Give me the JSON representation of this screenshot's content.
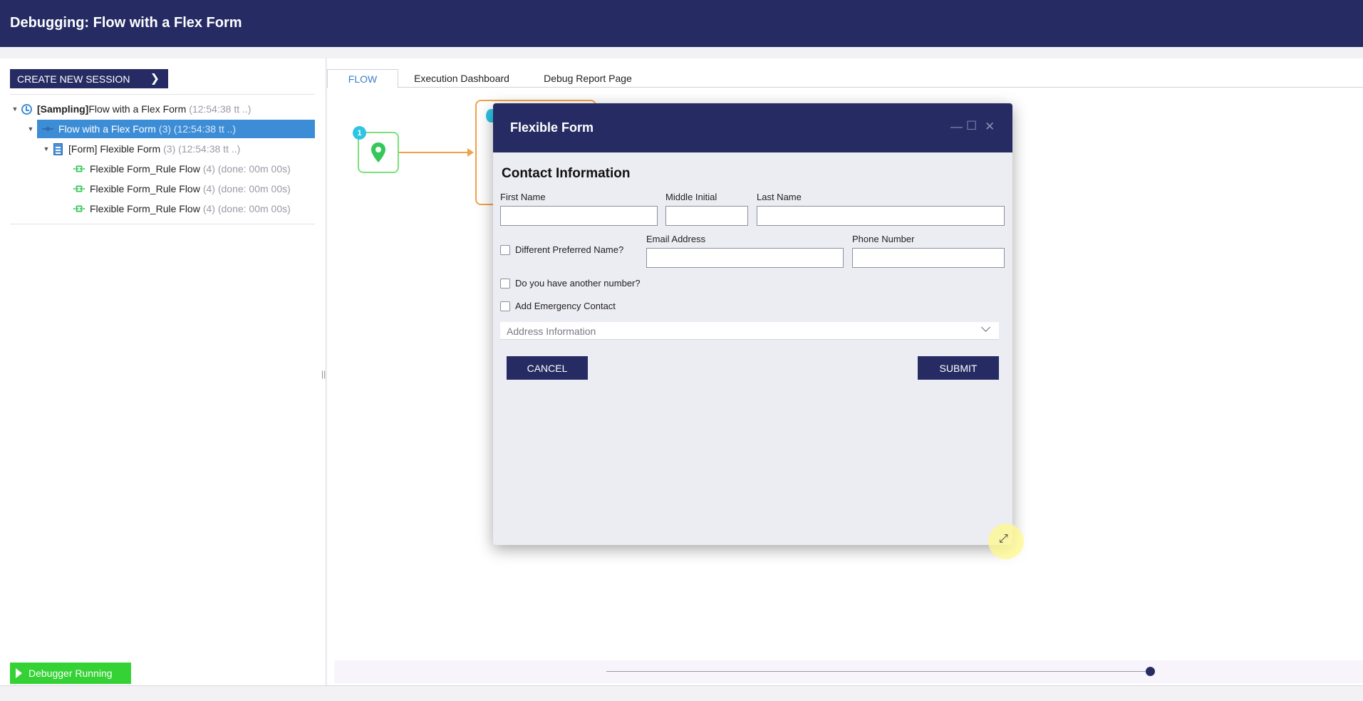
{
  "window": {
    "title": "Debugging: Flow with a Flex Form"
  },
  "left": {
    "create_session_label": "CREATE NEW SESSION",
    "tree": [
      {
        "bold_prefix": "[Sampling]",
        "label": " Flow with a Flex Form",
        "meta": "(12:54:38 tt ..)",
        "icon": "clock-icon"
      },
      {
        "label": "Flow with a Flex Form",
        "meta": "(3) (12:54:38 tt ..)",
        "icon": "flow-icon"
      },
      {
        "label": "[Form] Flexible Form",
        "meta": "(3) (12:54:38 tt ..)",
        "icon": "form-icon"
      },
      {
        "label": "Flexible Form_Rule Flow",
        "meta": "(4) (done: 00m 00s)",
        "icon": "rule-flow-icon"
      },
      {
        "label": "Flexible Form_Rule Flow",
        "meta": "(4) (done: 00m 00s)",
        "icon": "rule-flow-icon"
      },
      {
        "label": "Flexible Form_Rule Flow",
        "meta": "(4) (done: 00m 00s)",
        "icon": "rule-flow-icon"
      }
    ],
    "status": "Debugger Running"
  },
  "tabs": [
    {
      "label": "FLOW",
      "active": true
    },
    {
      "label": "Execution Dashboard",
      "active": false
    },
    {
      "label": "Debug Report Page",
      "active": false
    }
  ],
  "canvas": {
    "start_badge": "1"
  },
  "modal": {
    "title": "Flexible Form",
    "section_title": "Contact Information",
    "fields": {
      "first_name": {
        "label": "First Name",
        "value": ""
      },
      "middle_initial": {
        "label": "Middle Initial",
        "value": ""
      },
      "last_name": {
        "label": "Last Name",
        "value": ""
      },
      "email": {
        "label": "Email Address",
        "value": ""
      },
      "phone": {
        "label": "Phone Number",
        "value": ""
      }
    },
    "checkboxes": {
      "preferred_name": "Different Preferred Name?",
      "another_number": "Do you have another number?",
      "emergency_contact": "Add Emergency Contact"
    },
    "address_section": "Address Information",
    "cancel_label": "CANCEL",
    "submit_label": "SUBMIT"
  },
  "colors": {
    "navy": "#262c63",
    "selected": "#3c8dd6",
    "status_green": "#34d234",
    "connector_orange": "#f0a24a"
  }
}
